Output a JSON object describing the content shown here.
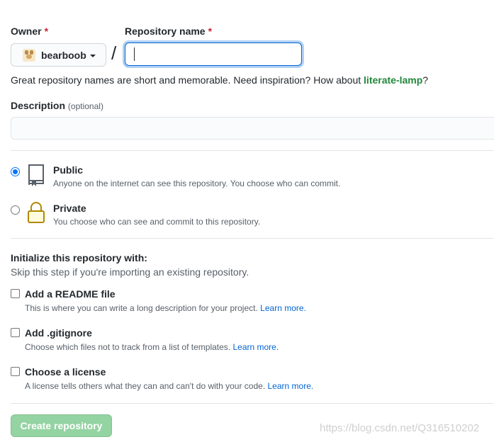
{
  "owner": {
    "label": "Owner",
    "required_mark": "*",
    "selected": "bearboob"
  },
  "separator": "/",
  "repo_name": {
    "label": "Repository name",
    "required_mark": "*",
    "value": ""
  },
  "hint": {
    "text": "Great repository names are short and memorable. Need inspiration? How about ",
    "suggestion": "literate-lamp",
    "end": "?"
  },
  "description": {
    "label": "Description",
    "optional": "(optional)",
    "value": ""
  },
  "visibility": {
    "public": {
      "title": "Public",
      "sub": "Anyone on the internet can see this repository. You choose who can commit.",
      "checked": true
    },
    "private": {
      "title": "Private",
      "sub": "You choose who can see and commit to this repository.",
      "checked": false
    }
  },
  "init": {
    "heading": "Initialize this repository with:",
    "sub": "Skip this step if you're importing an existing repository.",
    "options": [
      {
        "title": "Add a README file",
        "sub": "This is where you can write a long description for your project.",
        "link": "Learn more."
      },
      {
        "title": "Add .gitignore",
        "sub": "Choose which files not to track from a list of templates.",
        "link": "Learn more."
      },
      {
        "title": "Choose a license",
        "sub": "A license tells others what they can and can't do with your code.",
        "link": "Learn more."
      }
    ]
  },
  "create_button": "Create repository",
  "watermark": "https://blog.csdn.net/Q316510202"
}
